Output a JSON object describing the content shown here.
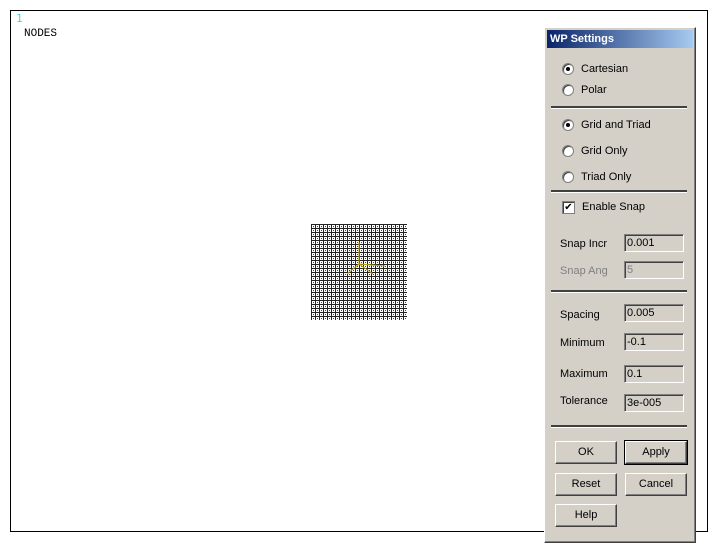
{
  "graphics": {
    "window_number": "1",
    "plot_title": "NODES"
  },
  "dialog": {
    "title": "WP Settings",
    "coord_system": {
      "options": [
        "Cartesian",
        "Polar"
      ],
      "selected": "Cartesian"
    },
    "display_mode": {
      "options": [
        "Grid and Triad",
        "Grid Only",
        "Triad Only"
      ],
      "selected": "Grid and Triad"
    },
    "enable_snap": {
      "label": "Enable Snap",
      "checked": true
    },
    "snap_incr": {
      "label": "Snap Incr",
      "value": "0.001"
    },
    "snap_ang": {
      "label": "Snap Ang",
      "value": "5",
      "disabled": true
    },
    "spacing": {
      "label": "Spacing",
      "value": "0.005"
    },
    "minimum": {
      "label": "Minimum",
      "value": "-0.1"
    },
    "maximum": {
      "label": "Maximum",
      "value": "0.1"
    },
    "tolerance": {
      "label": "Tolerance",
      "value": "3e-005"
    },
    "buttons": {
      "ok": "OK",
      "apply": "Apply",
      "reset": "Reset",
      "cancel": "Cancel",
      "help": "Help"
    }
  },
  "colors": {
    "titlebar_start": "#0a246a",
    "titlebar_end": "#a6caf0",
    "dialog_face": "#d4d0c8",
    "window_number": "#3fd8e0",
    "triad": "#c8a400"
  }
}
